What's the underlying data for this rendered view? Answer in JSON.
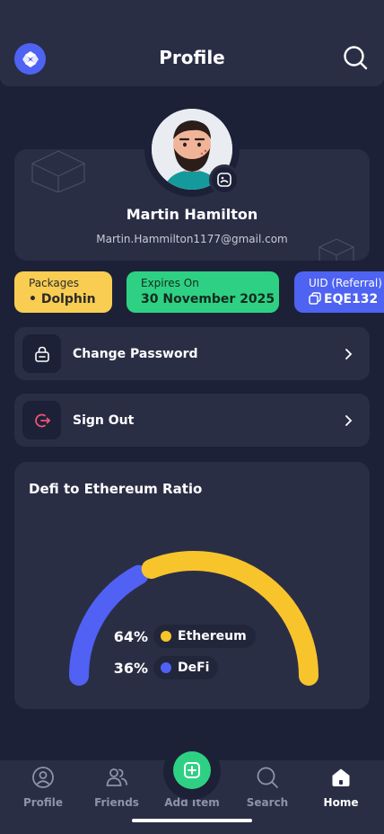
{
  "header": {
    "title": "Profile",
    "logo_icon": "app-logo-icon",
    "search_icon": "search-icon"
  },
  "profile": {
    "name": "Martin Hamilton",
    "email": "Martin.Hammilton1177@gmail.com",
    "avatar_icon": "avatar-icon",
    "edit_icon": "edit-photo-icon"
  },
  "chips": {
    "packages": {
      "label": "Packages",
      "value": "• Dolphin"
    },
    "expires": {
      "label": "Expires On",
      "value": "30 November 2025"
    },
    "uid": {
      "label": "UID (Referral)",
      "value": "EQE132"
    }
  },
  "menu": [
    {
      "label": "Change Password",
      "icon": "lock-icon"
    },
    {
      "label": "Sign Out",
      "icon": "sign-out-icon"
    }
  ],
  "ratio": {
    "title": "Defi to Ethereum Ratio",
    "legend": [
      {
        "pct": "64%",
        "name": "Ethereum"
      },
      {
        "pct": "36%",
        "name": "DeFi"
      }
    ]
  },
  "chart_data": {
    "type": "pie",
    "title": "Defi to Ethereum Ratio",
    "categories": [
      "Ethereum",
      "DeFi"
    ],
    "values": [
      64,
      36
    ],
    "colors": [
      "#f8c42b",
      "#5061f4"
    ]
  },
  "nav": [
    {
      "label": "Profile",
      "icon": "profile-icon"
    },
    {
      "label": "Friends",
      "icon": "friends-icon"
    },
    {
      "label": "Add Item",
      "icon": "add-item-icon"
    },
    {
      "label": "Search",
      "icon": "search-icon"
    },
    {
      "label": "Home",
      "icon": "home-icon"
    }
  ],
  "colors": {
    "accent": "#4e63f2",
    "yellow": "#f8cd52",
    "green": "#2ed183",
    "card": "#2a2e45",
    "bg": "#1d2137"
  }
}
